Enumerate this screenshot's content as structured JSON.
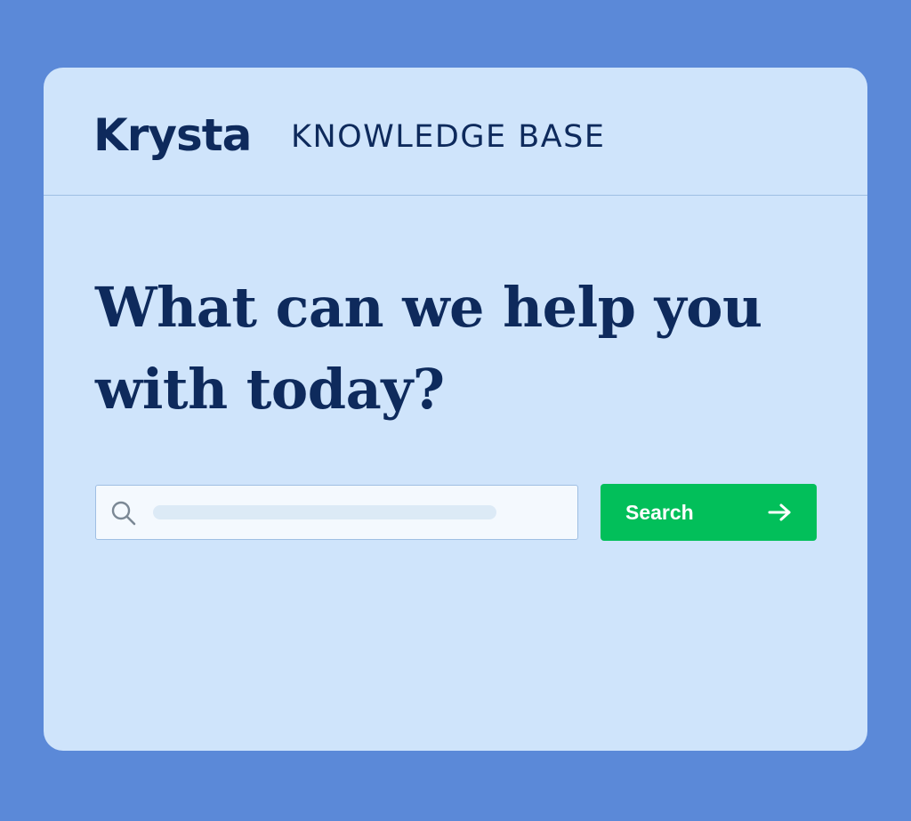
{
  "header": {
    "logo_text": "Krysta",
    "section_label": "KNOWLEDGE BASE"
  },
  "hero": {
    "headline": "What can we help you with today?"
  },
  "search": {
    "input_value": "",
    "placeholder": "",
    "icon": "search-icon",
    "button_label": "Search",
    "button_icon": "arrow-right-icon"
  },
  "colors": {
    "page_background": "#5b89d8",
    "card_background": "#cfe4fb",
    "text_primary": "#0e2a5c",
    "accent_button": "#02bf5a"
  }
}
